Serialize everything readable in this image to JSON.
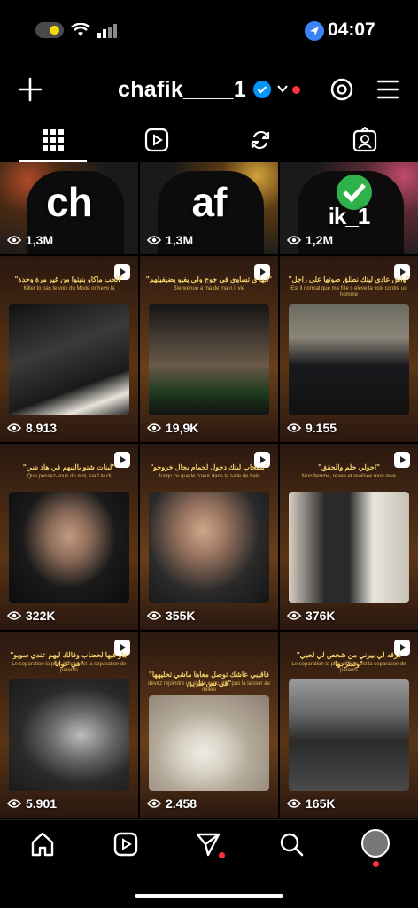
{
  "status": {
    "time": "04:07"
  },
  "header": {
    "username": "chafik____1"
  },
  "tabs": [
    "posts-grid",
    "reels",
    "reposts",
    "tagged"
  ],
  "grid": {
    "row1": [
      {
        "overlay": "ch",
        "views": "1,3M"
      },
      {
        "overlay": "af",
        "views": "1,3M"
      },
      {
        "overlay": "ik_1",
        "views": "1,2M"
      }
    ],
    "row2": [
      {
        "caption": "\"الحب ماكاو بنيتوا من غير مرة وحدة\"",
        "subcaption": "Killer to pas le voix du Mode or heyo la",
        "views": "8.913"
      },
      {
        "caption": "\"انها ي تساوي في جوج ولي يفيو يضيفيلهم\"",
        "subcaption": "Bienvenue a ma de ma n il vie",
        "views": "19,9K"
      },
      {
        "caption": "\"واش عادي ليتك نطلق صوتها على راجل\"",
        "subcaption": "Est il normal que ma fille s eleve la voix contre un homme",
        "views": "9.155"
      }
    ],
    "row3": [
      {
        "caption": "\"لبنات شنو بالنيهم في هاد شي\"",
        "subcaption": "Que pensez-vous du moi, sauf le cli",
        "views": "322K"
      },
      {
        "caption": "\"يصحاب ليتك دخول لحمام بجال خروجو\"",
        "subcaption": "Jusqu ce que le coeur dans la salle de bain",
        "views": "355K"
      },
      {
        "caption": "\"احولي حلم والحقق\"",
        "subcaption": "Mon femme, revee et realisee mon reve",
        "views": "376K"
      }
    ],
    "row4": [
      {
        "caption": "\"جاو قبها لحضاب وقالك ليهم عندي سوبو في حوانا\"",
        "subcaption": "Le separation la plus difficile est la separation de parents",
        "views": "5.901"
      },
      {
        "caption": "\"فاقيبي عاشك توصل معاها ماشي تحليهها في نص طريق\"",
        "subcaption": "devez rejoindre un stade avec elle, pas la laisser au milieu",
        "views": "2.458"
      },
      {
        "caption": "\"فرقه لي بيرني من شخص لي لحبي وتعترجها\"",
        "subcaption": "Le separation la plus difficile est la separation de parents",
        "views": "165K"
      }
    ]
  },
  "colors": {
    "accent_blue": "#3b82f6",
    "notif_red": "#ff3040",
    "verified": "#0095f6"
  }
}
